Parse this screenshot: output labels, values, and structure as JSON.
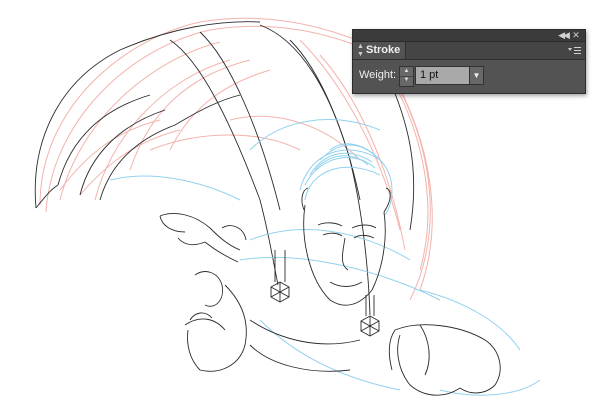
{
  "stroke_panel": {
    "tab_title": "Stroke",
    "weight_label": "Weight:",
    "weight_value": "1 pt",
    "collapse_icon": "double-chevron-left-icon",
    "close_icon": "close-icon",
    "menu_icon": "panel-menu-icon"
  },
  "colors": {
    "panel_bg": "#535353",
    "sketch_red": "#f1a7a0",
    "sketch_blue": "#8fd0ee",
    "ink_line": "#2b2b2b"
  }
}
